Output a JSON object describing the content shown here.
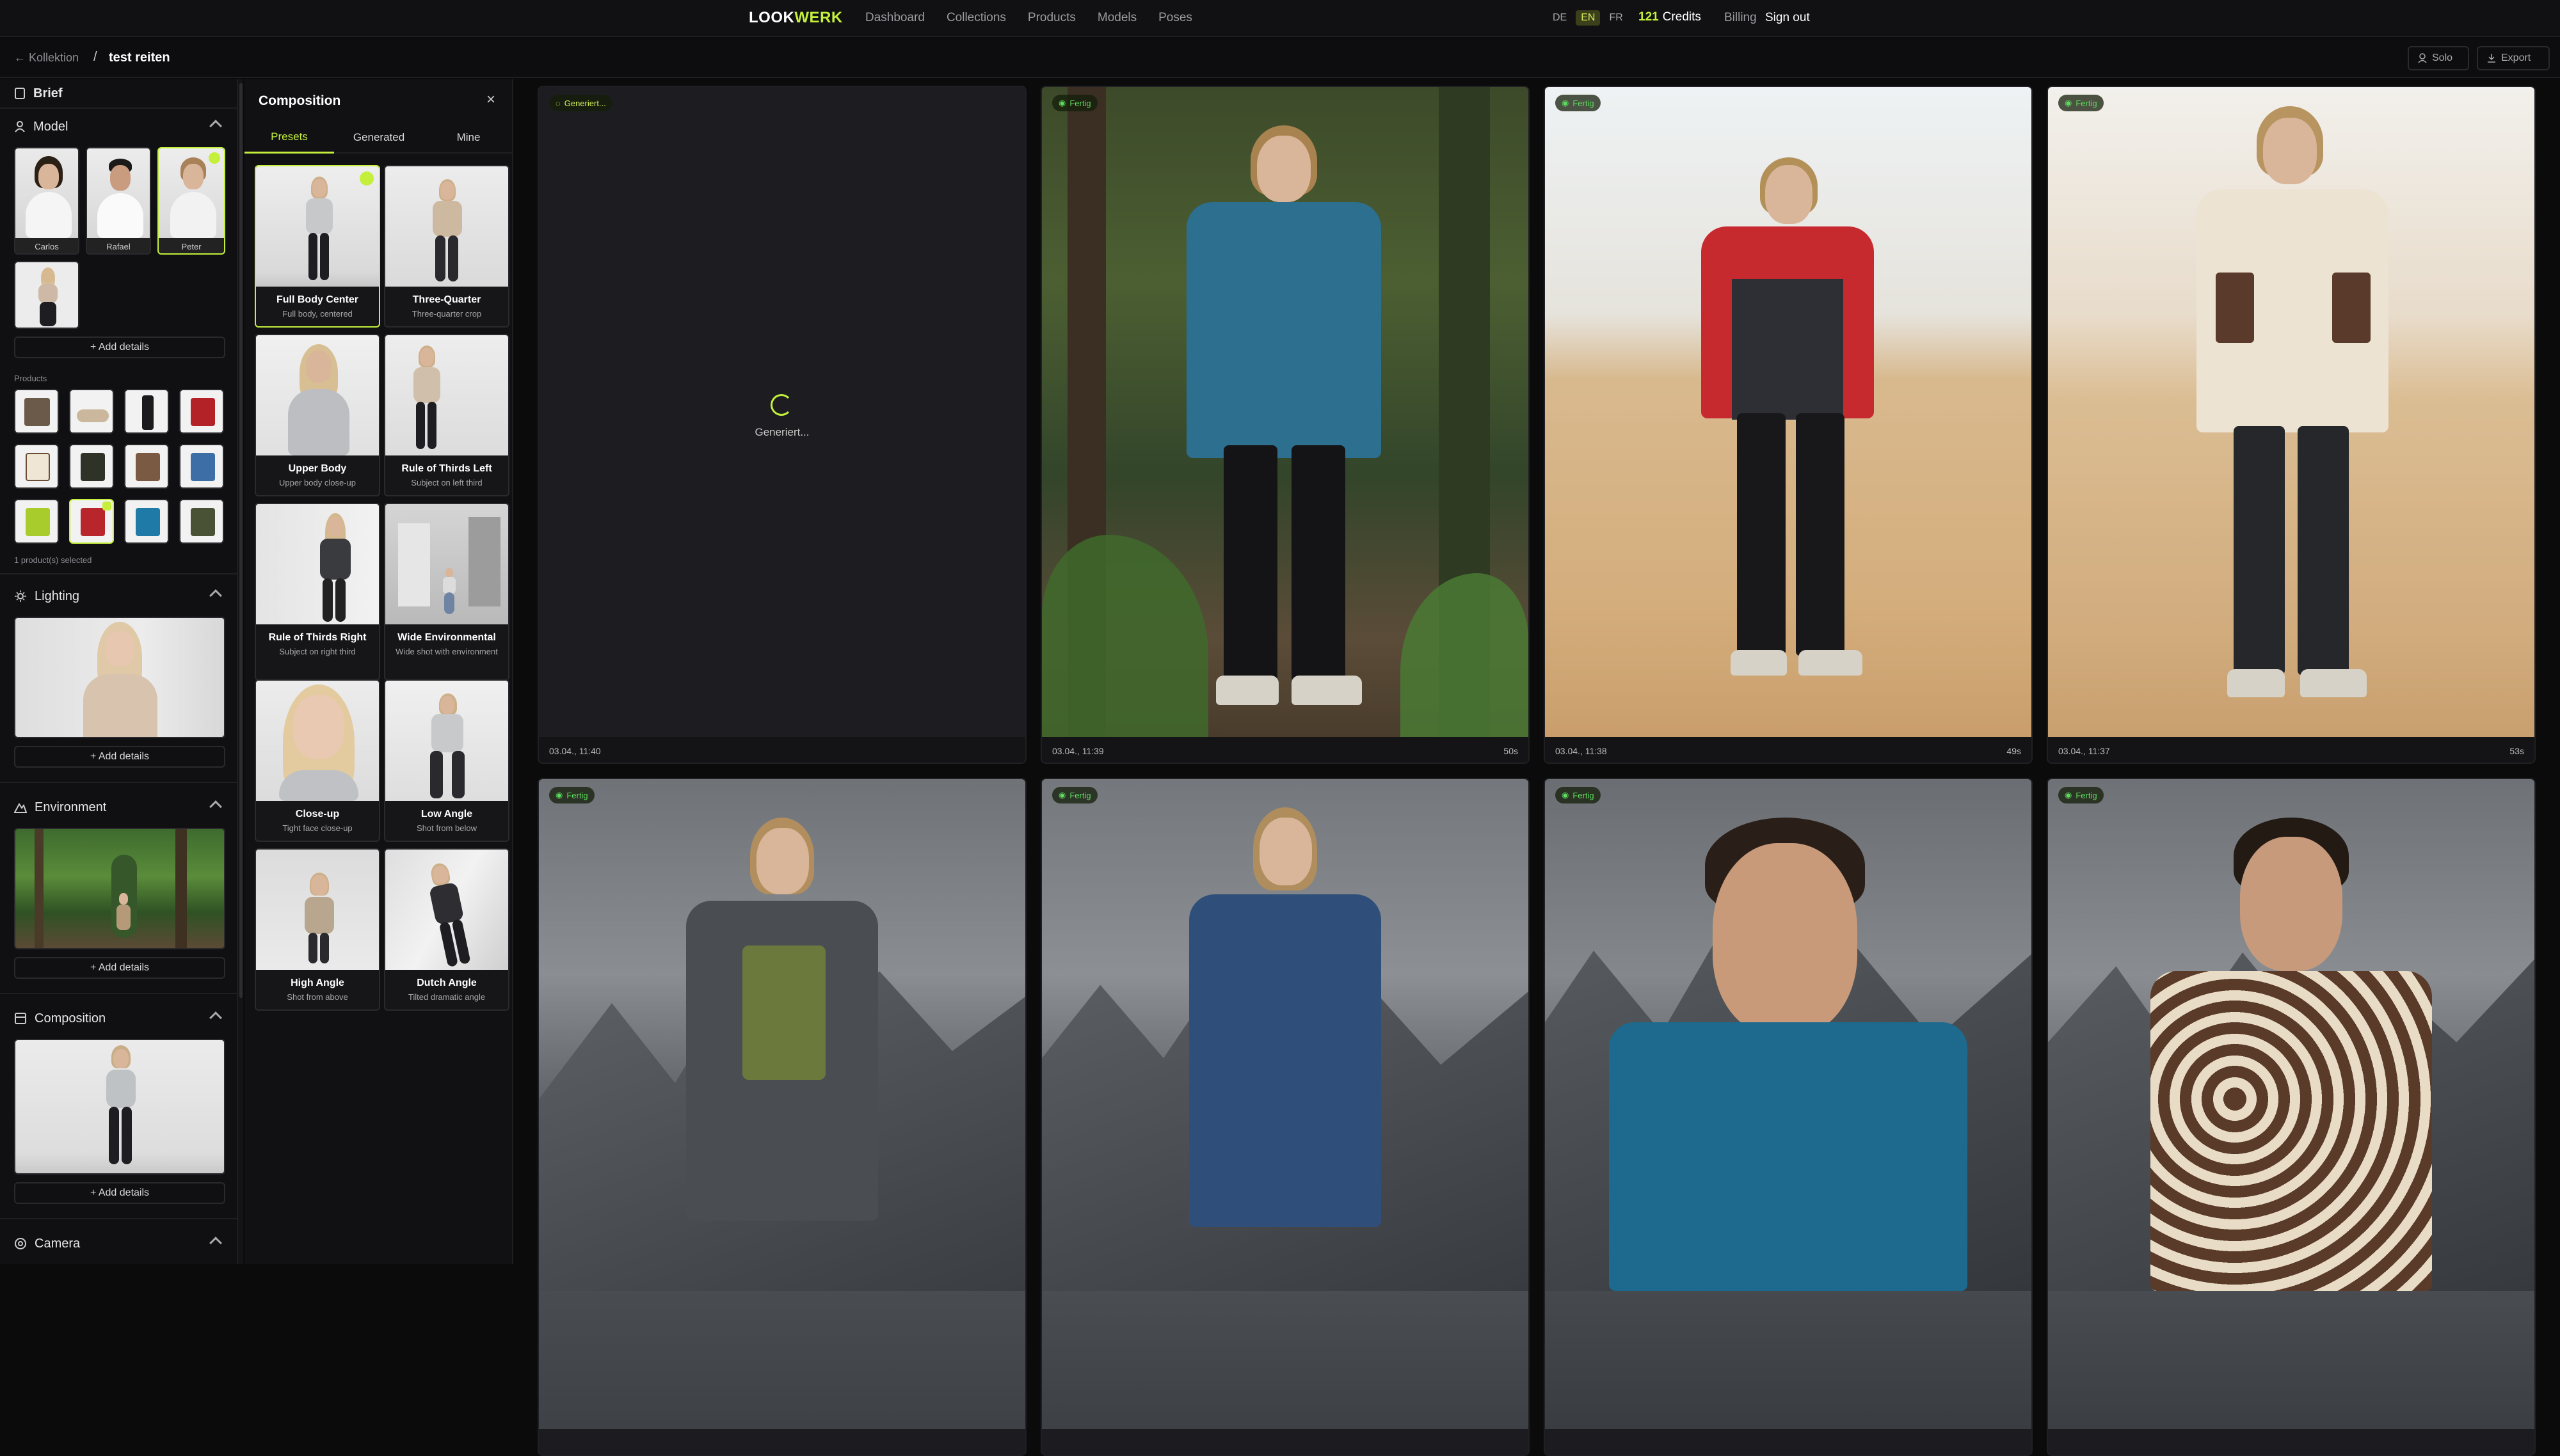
{
  "nav": {
    "logo_a": "LOOK",
    "logo_b": "WERK",
    "links": [
      "Dashboard",
      "Collections",
      "Products",
      "Models",
      "Poses"
    ],
    "languages": [
      "DE",
      "EN",
      "FR"
    ],
    "active_language": "EN",
    "credits_value": "121",
    "credits_label": "Credits",
    "billing": "Billing",
    "signout": "Sign out"
  },
  "subbar": {
    "back_label": "Kollektion",
    "separator": "/",
    "current": "test reiten",
    "solo_label": "Solo",
    "export_label": "Export"
  },
  "sidebar": {
    "brief": "Brief",
    "model_title": "Model",
    "models": [
      {
        "name": "Carlos",
        "selected": false
      },
      {
        "name": "Rafael",
        "selected": false
      },
      {
        "name": "Peter",
        "selected": true
      }
    ],
    "add_details": "+ Add details",
    "products_label": "Products",
    "products_selected": "1 product(s) selected",
    "lighting_title": "Lighting",
    "environment_title": "Environment",
    "composition_title": "Composition",
    "camera_title": "Camera"
  },
  "panel": {
    "title": "Composition",
    "close": "×",
    "tabs": [
      "Presets",
      "Generated",
      "Mine"
    ],
    "active_tab": "Presets",
    "presets": [
      {
        "title": "Full Body Center",
        "desc": "Full body, centered",
        "selected": true
      },
      {
        "title": "Three-Quarter",
        "desc": "Three-quarter crop",
        "selected": false
      },
      {
        "title": "Upper Body",
        "desc": "Upper body close-up",
        "selected": false
      },
      {
        "title": "Rule of Thirds Left",
        "desc": "Subject on left third",
        "selected": false
      },
      {
        "title": "Rule of Thirds Right",
        "desc": "Subject on right third",
        "selected": false
      },
      {
        "title": "Wide Environmental",
        "desc": "Wide shot with environment",
        "selected": false
      },
      {
        "title": "Close-up",
        "desc": "Tight face close-up",
        "selected": false
      },
      {
        "title": "Low Angle",
        "desc": "Shot from below",
        "selected": false
      },
      {
        "title": "High Angle",
        "desc": "Shot from above",
        "selected": false
      },
      {
        "title": "Dutch Angle",
        "desc": "Tilted dramatic angle",
        "selected": false
      }
    ]
  },
  "gallery": {
    "tiles": [
      {
        "status": "Generiert...",
        "state": "generating",
        "center_text": "Generiert...",
        "date": "03.04., 11:40",
        "duration": ""
      },
      {
        "status": "Fertig",
        "state": "done",
        "date": "03.04., 11:39",
        "duration": "50s"
      },
      {
        "status": "Fertig",
        "state": "done",
        "date": "03.04., 11:38",
        "duration": "49s"
      },
      {
        "status": "Fertig",
        "state": "done",
        "date": "03.04., 11:37",
        "duration": "53s"
      },
      {
        "status": "Fertig",
        "state": "done"
      },
      {
        "status": "Fertig",
        "state": "done"
      },
      {
        "status": "Fertig",
        "state": "done"
      },
      {
        "status": "Fertig",
        "state": "done"
      }
    ]
  },
  "colors": {
    "accent": "#c4f03c",
    "done": "#5ddc5d",
    "background": "#0b0b0c"
  }
}
